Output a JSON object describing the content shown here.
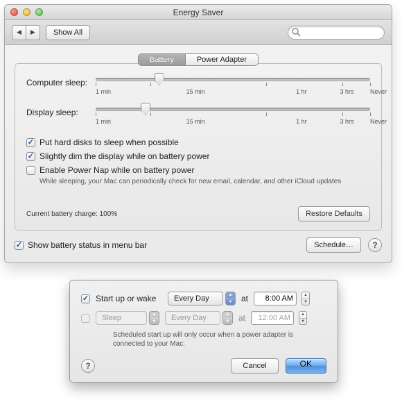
{
  "window": {
    "title": "Energy Saver",
    "show_all_label": "Show All",
    "search_placeholder": ""
  },
  "tabs": {
    "battery": "Battery",
    "power_adapter": "Power Adapter",
    "active": "battery"
  },
  "sliders": {
    "computer": {
      "label": "Computer sleep:",
      "value_pct": 23,
      "tick_labels": [
        "1 min",
        "15 min",
        "1 hr",
        "3 hrs",
        "Never"
      ]
    },
    "display": {
      "label": "Display sleep:",
      "value_pct": 18,
      "tick_labels": [
        "1 min",
        "15 min",
        "1 hr",
        "3 hrs",
        "Never"
      ]
    }
  },
  "checkboxes": {
    "hdd_sleep": {
      "checked": true,
      "label": "Put hard disks to sleep when possible"
    },
    "dim_display": {
      "checked": true,
      "label": "Slightly dim the display while on battery power"
    },
    "power_nap": {
      "checked": false,
      "label": "Enable Power Nap while on battery power",
      "note": "While sleeping, your Mac can periodically check for new email, calendar, and other iCloud updates"
    },
    "menubar": {
      "checked": true,
      "label": "Show battery status in menu bar"
    }
  },
  "battery_status": "Current battery charge: 100%",
  "restore_defaults_label": "Restore Defaults",
  "schedule_label": "Schedule…",
  "sheet": {
    "startup": {
      "checked": true,
      "label": "Start up or wake",
      "day": "Every Day",
      "at": "at",
      "time": "8:00 AM"
    },
    "sleep": {
      "checked": false,
      "action": "Sleep",
      "day": "Every Day",
      "at": "at",
      "time": "12:00 AM"
    },
    "note": "Scheduled start up will only occur when a power adapter is connected to your Mac.",
    "cancel": "Cancel",
    "ok": "OK"
  }
}
